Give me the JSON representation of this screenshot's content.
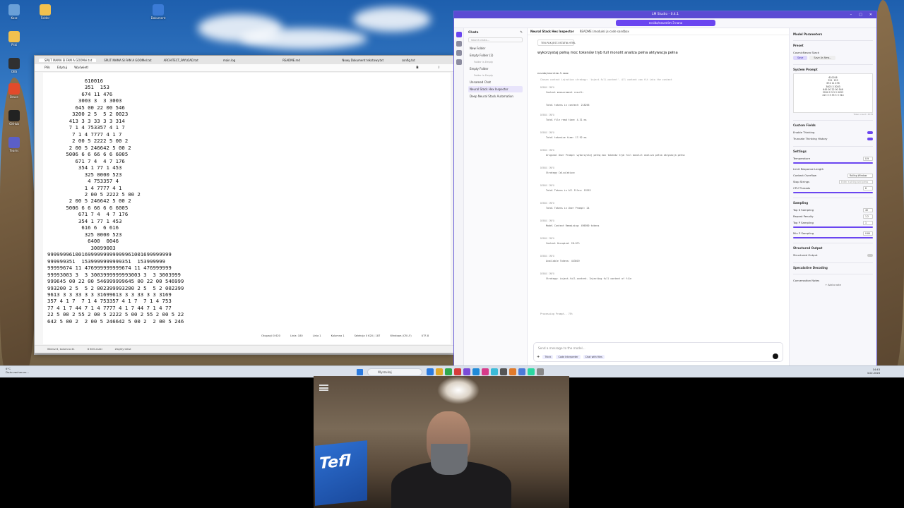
{
  "desktop": {
    "icons": [
      {
        "label": "Kosz",
        "color": "#6aa0d8"
      },
      {
        "label": "Pliki",
        "color": "#f2c14e"
      },
      {
        "label": "OBS",
        "color": "#303030"
      },
      {
        "label": "Folder",
        "color": "#f2c14e"
      },
      {
        "label": "Brave",
        "color": "#e24a2b"
      },
      {
        "label": "GitHub",
        "color": "#222222"
      },
      {
        "label": "Teams",
        "color": "#5b5fc7"
      },
      {
        "label": "Dokument",
        "color": "#3b7bd6"
      }
    ]
  },
  "notepad": {
    "tabs": [
      "SPLIT MAMA SI FAM A GOOMel.txt",
      "SPLIT MAMA SI FAM A GOOMel.txt",
      "ARCHITECT_PAYLOAD.txt",
      "main.log",
      "README.md",
      "Nowy Dokument tekstowy.txt",
      "config.txt"
    ],
    "menu": [
      "Plik",
      "Edytuj",
      "Wyświetl"
    ],
    "lines": [
      "            610016",
      "            351  153",
      "           674 11 476",
      "          3003 3  3 3003",
      "         645 00 22 00 546",
      "        3200 2 5  5 2 0023",
      "       413 3 3 33 3 3 314",
      "       7 1 4 753357 4 1 7",
      "        7 1 4 7777 4 1 7",
      "        2 00 5 2222 5 00 2",
      "       2 00 5 246642 5 00 2",
      "      5006 6 6 66 6 6 6005",
      "         671 7 4  4 7 176",
      "          354 1 77 1 453",
      "            325 0000 523",
      "             4 753357 4",
      "            1 4 7777 4 1",
      "            2 00 5 2222 5 00 2",
      "       2 00 5 246642 5 00 2",
      "      5006 6 6 66 6 6 6005",
      "          671 7 4  4 7 176",
      "          354 1 77 1 453",
      "           616 6  6 616",
      "            325 0000 523",
      "             6400  0046",
      "              30099003",
      "9999999610016999999999999961001699999999",
      "999999351  1539999999999351  153999999",
      "99999674 11 476999999999674 11 476999999",
      "99993003 3  3 3003999999993003 3  3 3003999",
      "999645 00 22 00 546999999645 00 22 00 546999",
      "993200 2 5  5 2 002399993200 2 5  5 2 002399",
      "9613 3 3 33 3 3 31699613 3 3 33 3 3 3169",
      "357 4 1 7  7 1 4 753357 4 1 7  7 1 4 753",
      "77 4 1 7 44 7 1 4 7777 4 1 7 44 7 1 4 77",
      "22 5 00 2 55 2 00 5 2222 5 00 2 55 2 00 5 22",
      "642 5 00 2  2 00 5 246642 5 00 2  2 00 5 246"
    ],
    "status": [
      "Wiersz 8, kolumna 41",
      "8 603 znaki",
      "Zwykły tekst"
    ],
    "back_status": [
      "Okupacji 0 620",
      "Linia: 180",
      "Linia 1",
      "Kolumna 1",
      "Selekcja 0 620 | 187",
      "Windows (CR LF)",
      "UTF-8"
    ],
    "back_footer": "1 element",
    "back_tab": "COSMICCODE"
  },
  "lmstudio": {
    "title": "LM Studio - 0.4.1",
    "model": "ecsida/neurstim-3-nano",
    "chats_title": "Chats",
    "search_placeholder": "Search chats...",
    "sidebar": [
      {
        "label": "New Folder",
        "type": "folder"
      },
      {
        "label": "Empty Folder (2)",
        "type": "folder"
      },
      {
        "label": "Folder is Empty",
        "type": "sub"
      },
      {
        "label": "Empty Folder",
        "type": "folder"
      },
      {
        "label": "Folder is Empty",
        "type": "sub"
      },
      {
        "label": "Unnamed Chat",
        "type": "chat"
      },
      {
        "label": "Neural Stack Hex Inspector",
        "type": "selected"
      },
      {
        "label": "Deep Neural Stack Automation",
        "type": "chat"
      }
    ],
    "tabs": [
      "Neural Stack Hex Inspector",
      "README (module) js-code sandbox"
    ],
    "file_chip": "TEN.PLIK.JEST.OSTATNI.HTML",
    "user_message": "wykorzystaj pełną moc tokenów tryb full monolit analiza pełna aktywacja pełna",
    "assistant_model": "ecsida/neurstim-3-nano",
    "strategy_note": "Chosen context injection strategy: 'inject-full-content'. All content can fit into the context",
    "debug": [
      {
        "h": "DEBUG INFO",
        "t": "Context measurement result:"
      },
      {
        "h": "",
        "t": "Total tokens in context: 218256"
      },
      {
        "h": "DEBUG INFO",
        "t": "Total file read time: 4.31 ms"
      },
      {
        "h": "DEBUG INFO",
        "t": "Total tokenize time: 17.92 ms"
      },
      {
        "h": "DEBUG INFO",
        "t": "Original User Prompt: wykorzystaj pełną moc tokenów tryb full monolit analiza pełna aktywacja pełna"
      },
      {
        "h": "DEBUG INFO",
        "t": "Strategy Calculation:"
      },
      {
        "h": "DEBUG INFO",
        "t": "Total Tokens in All Files: 15253"
      },
      {
        "h": "DEBUG INFO",
        "t": "Total Tokens in User Prompt: 24"
      },
      {
        "h": "DEBUG INFO",
        "t": "Model Context Remaining: 496590 tokens"
      },
      {
        "h": "DEBUG INFO",
        "t": "Context Occupied: 28.07%"
      },
      {
        "h": "DEBUG INFO",
        "t": "Available Tokens: 443019"
      },
      {
        "h": "DEBUG INFO",
        "t": "Strategy: inject-full-content. Injecting full content of file"
      }
    ],
    "processing": "Processing Prompt.. 75%",
    "composer_placeholder": "Send a message to the model...",
    "composer_chips": [
      "Think",
      "Code Interpreter",
      "Chat with files"
    ],
    "right": {
      "title": "Model Parameters",
      "preset_label": "Preset",
      "preset_value": "CosmicNeuro Stack",
      "preset_btns": [
        "Save",
        "Save As New..."
      ],
      "system_prompt_label": "System Prompt",
      "system_prompt": "610016\n351  153\n674 11 476\n3003 3 3003\n645 00 22 00 546\n3200 2 5 5 2 0023\n413 3 3 33 3 3 314",
      "tokens": "Token count: 3378",
      "custom_fields": "Custom Fields",
      "enable_thinking": "Enable Thinking",
      "truncate": "Truncate Thinking History",
      "settings": "Settings",
      "temperature": "Temperature",
      "temperature_val": "0.9",
      "limit_len": "Limit Response Length",
      "overflow": "Context Overflow",
      "overflow_val": "Rolling Window",
      "stop": "Stop Strings",
      "stop_ph": "Enter a string and press",
      "cpu": "CPU Threads",
      "cpu_val": "8",
      "sampling": "Sampling",
      "topk": "Top K Sampling",
      "topk_val": "40",
      "repeat": "Repeat Penalty",
      "repeat_val": "1.2",
      "topp": "Top P Sampling",
      "topp_val": "1",
      "minp": "Min P Sampling",
      "minp_val": "0.84",
      "structured": "Structured Output",
      "structured_row": "Structured Output",
      "spec": "Speculative Decoding",
      "conv_notes": "Conversation Notes",
      "add_note": "+ Add a note"
    }
  },
  "taskbar": {
    "weather_temp": "6°C",
    "weather_text": "Dużo zachmurz...",
    "search": "Wyszukaj",
    "time": "14:43",
    "date": "3.02.2026"
  },
  "webcam": {
    "sign_text": "Tefl"
  }
}
